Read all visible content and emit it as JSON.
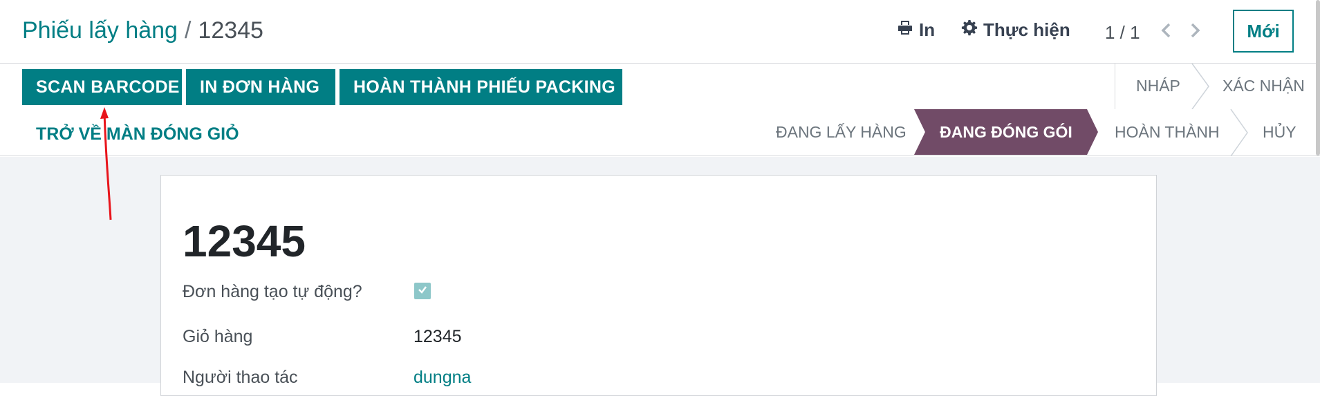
{
  "breadcrumb": {
    "parent": "Phiếu lấy hàng",
    "separator": "/",
    "current": "12345"
  },
  "toolbar": {
    "print_label": "In",
    "action_label": "Thực hiện",
    "pager": "1 / 1",
    "new_label": "Mới"
  },
  "actions": {
    "scan_barcode": "SCAN BARCODE",
    "print_order": "IN ĐƠN HÀNG",
    "finish_packing": "HOÀN THÀNH PHIẾU PACKING",
    "back_to_cart": "TRỞ VỀ MÀN ĐÓNG GIỎ"
  },
  "stages": {
    "draft": "NHÁP",
    "confirmed": "XÁC NHẬN",
    "picking": "ĐANG LẤY HÀNG",
    "packing": "ĐANG ĐÓNG GÓI",
    "done": "HOÀN THÀNH",
    "cancel": "HỦY",
    "active": "packing"
  },
  "form": {
    "title": "12345",
    "fields": [
      {
        "label": "Đơn hàng tạo tự động?",
        "type": "checkbox",
        "checked": true
      },
      {
        "label": "Giỏ hàng",
        "value": "12345"
      },
      {
        "label": "Người thao tác",
        "value": "dungna"
      }
    ]
  },
  "colors": {
    "primary": "#017e84",
    "active_stage": "#714b67",
    "annotation_arrow": "#e8141b"
  },
  "icons": [
    "print-icon",
    "gear-icon",
    "chevron-left-icon",
    "chevron-right-icon",
    "check-icon"
  ]
}
